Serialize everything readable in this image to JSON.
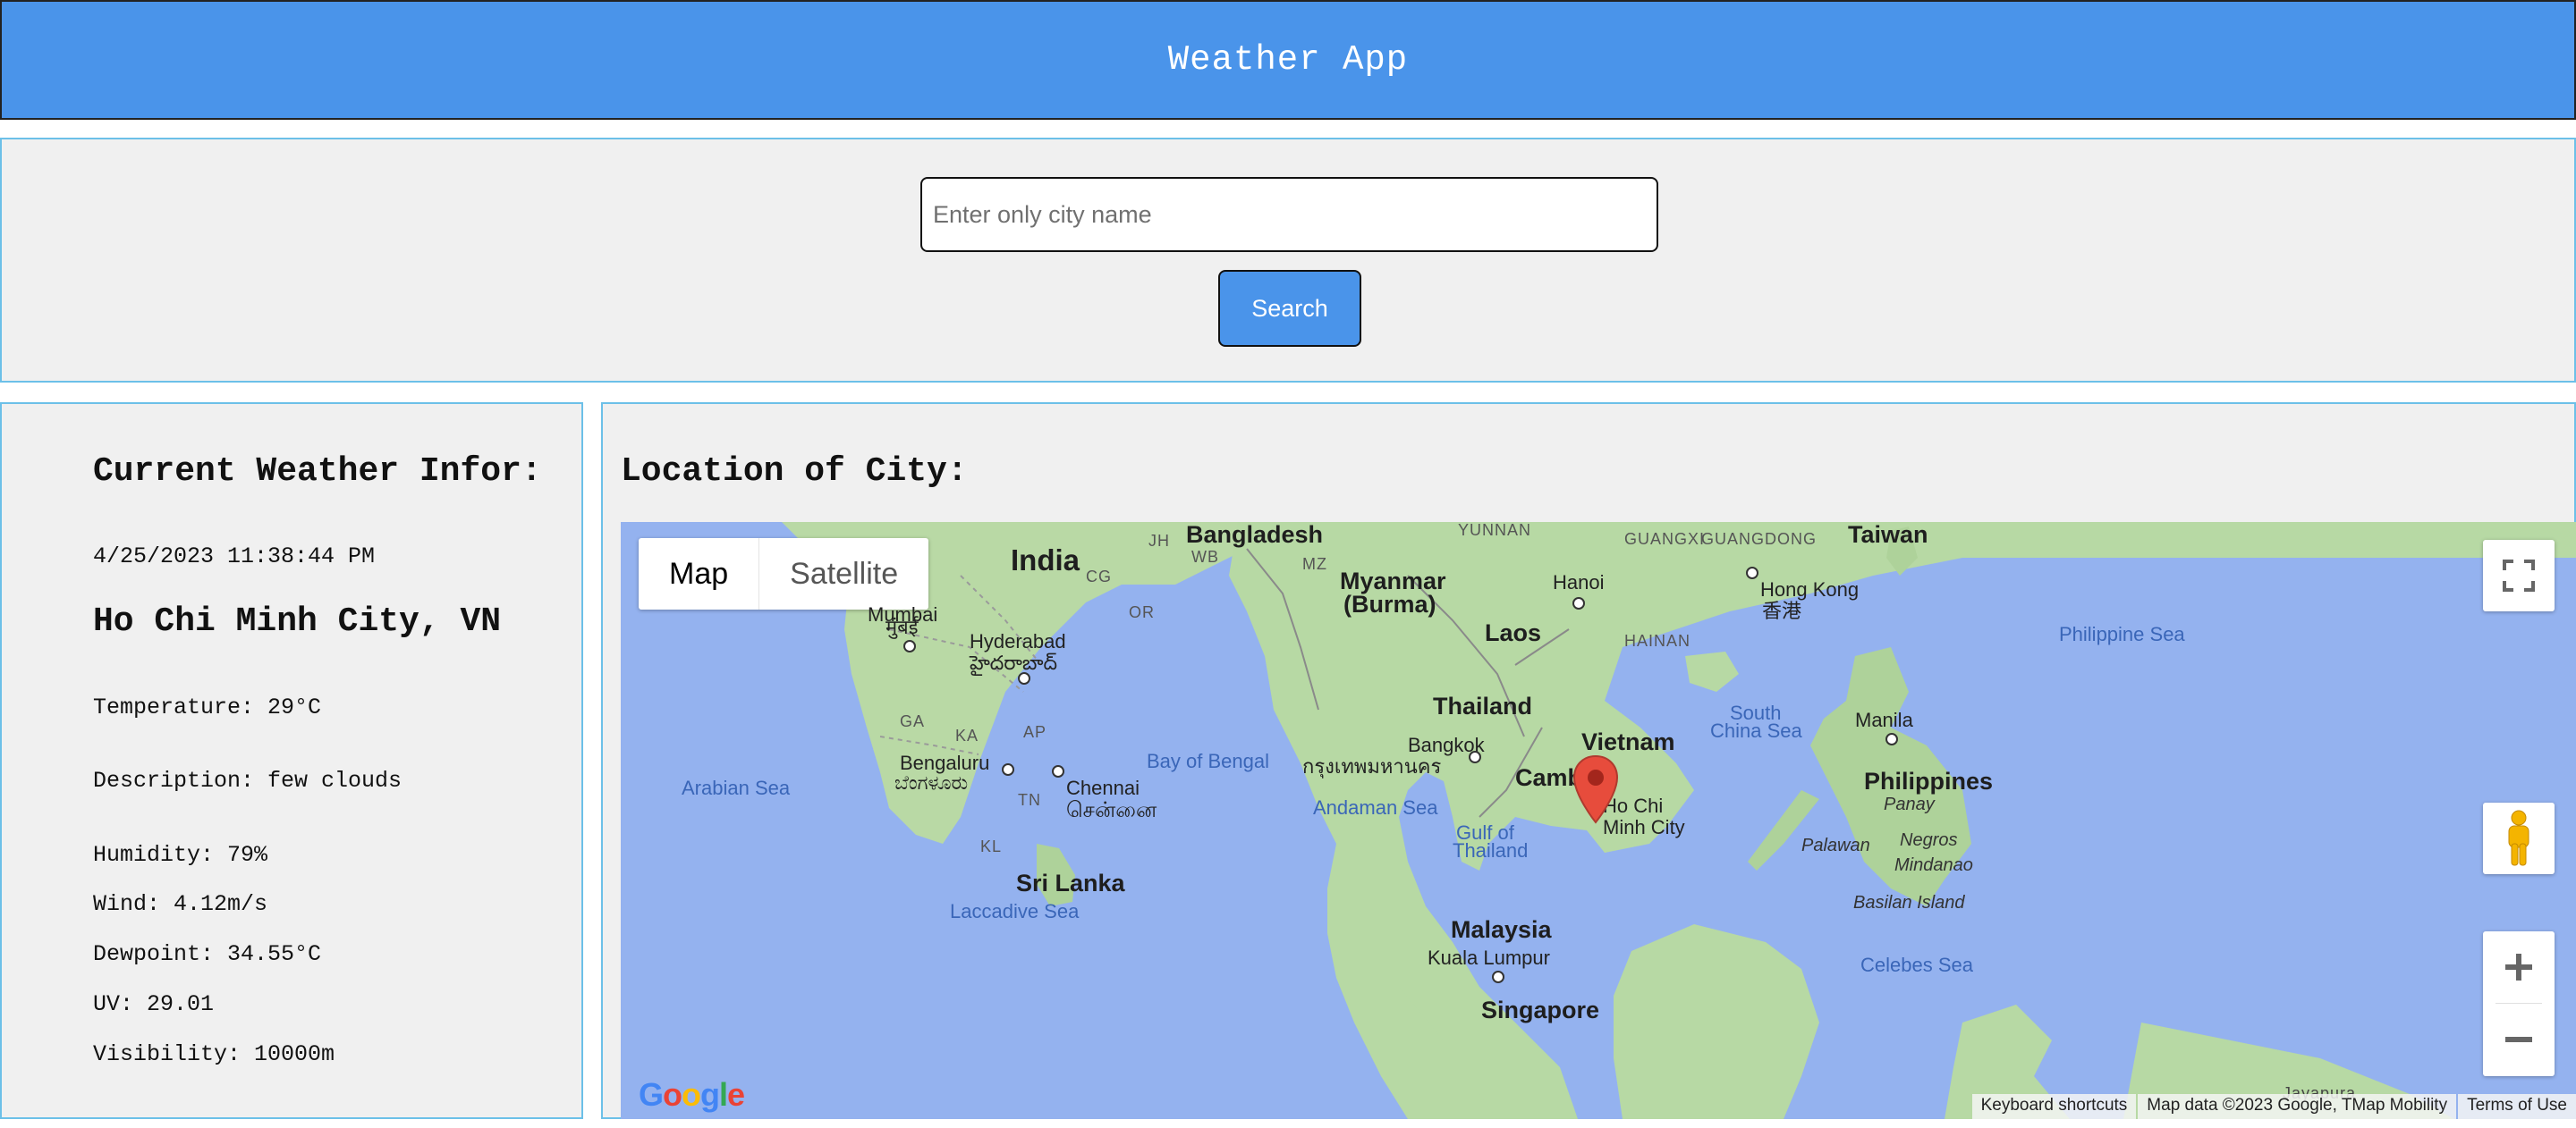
{
  "header": {
    "title": "Weather App"
  },
  "colors": {
    "header_bg": "#4a94ea",
    "button_bg": "#4a94ea",
    "panel_border": "#6cc0e8",
    "panel_bg": "#f0f0f0",
    "map_water": "#94b2ef",
    "map_land": "#b7d9a4",
    "marker": "#e74c3c"
  },
  "search": {
    "placeholder": "Enter only city name",
    "value": "",
    "button_label": "Search"
  },
  "weather": {
    "heading": "Current Weather Infor:",
    "datetime": "4/25/2023 11:38:44 PM",
    "city": "Ho Chi Minh City, VN",
    "temperature": "Temperature: 29°C",
    "description": "Description: few clouds",
    "humidity": "Humidity: 79%",
    "wind": "Wind: 4.12m/s",
    "dewpoint": "Dewpoint: 34.55°C",
    "uv": "UV: 29.01",
    "visibility": "Visibility: 10000m"
  },
  "map_panel": {
    "heading": "Location of City:",
    "map_type": {
      "map_label": "Map",
      "satellite_label": "Satellite",
      "selected": "Map"
    },
    "controls": {
      "fullscreen_icon": "fullscreen-icon",
      "pegman_icon": "pegman-icon",
      "zoom_in": "+",
      "zoom_out": "−"
    },
    "labels": {
      "bangladesh": "Bangladesh",
      "india": "India",
      "myanmar": "Myanmar",
      "burma": "(Burma)",
      "laos": "Laos",
      "thailand": "Thailand",
      "vietnam": "Vietnam",
      "cambodia": "Camb",
      "philippines": "Philippines",
      "malaysia": "Malaysia",
      "taiwan": "Taiwan",
      "sri_lanka": "Sri Lanka",
      "yunnan": "YUNNAN",
      "guangxi": "GUANGXI",
      "guangdong": "GUANGDONG",
      "hainan": "HAINAN",
      "jh": "JH",
      "wb": "WB",
      "mz": "MZ",
      "cg": "CG",
      "or": "OR",
      "ga": "GA",
      "ka": "KA",
      "ap": "AP",
      "tn": "TN",
      "kl": "KL",
      "hanoi": "Hanoi",
      "hong_kong": "Hong Kong",
      "hong_kong_local": "香港",
      "hyderabad": "Hyderabad",
      "hyderabad_local": "హైదరాబాద్",
      "mumbai_en": "Mumbai",
      "mumbai_local": "मुंबई",
      "bengaluru": "Bengaluru",
      "bengaluru_local": "ಬೆಂಗಳೂರು",
      "chennai": "Chennai",
      "chennai_local": "சென்னை",
      "bangkok": "Bangkok",
      "bangkok_local": "กรุงเทพมหานคร",
      "ho_chi": "Ho Chi",
      "minh_city": "Minh City",
      "manila": "Manila",
      "kuala_lumpur": "Kuala Lumpur",
      "singapore": "Singapore",
      "panay": "Panay",
      "negros": "Negros",
      "mindanao": "Mindanao",
      "palawan": "Palawan",
      "basilan": "Basilan Island",
      "javapura": "Jayapura",
      "philippine_sea": "Philippine Sea",
      "south_china_sea_1": "South",
      "south_china_sea_2": "China Sea",
      "arabian_sea": "Arabian Sea",
      "bay_of_bengal": "Bay of Bengal",
      "andaman_sea": "Andaman Sea",
      "gulf_1": "Gulf of",
      "gulf_2": "Thailand",
      "laccadive_sea": "Laccadive Sea",
      "celebes_sea": "Celebes Sea"
    },
    "attribution": {
      "keyboard": "Keyboard shortcuts",
      "map_data": "Map data ©2023 Google, TMap Mobility",
      "terms": "Terms of Use"
    },
    "logo": "Google"
  }
}
